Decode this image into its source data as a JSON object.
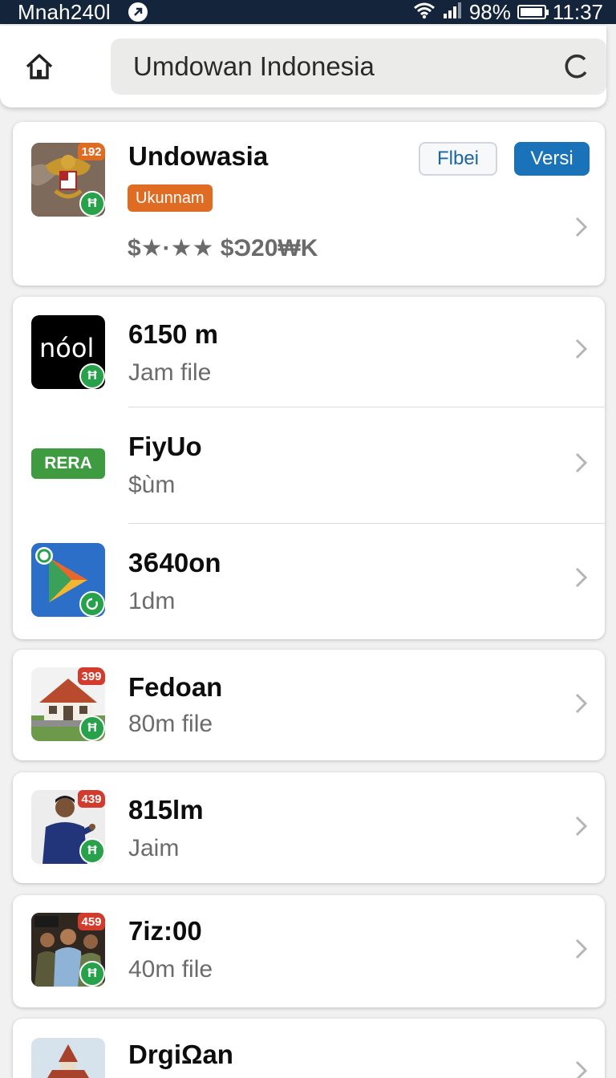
{
  "status_bar": {
    "carrier": "Mnah240l",
    "battery": "98%",
    "battery_level": 0.98,
    "time": "11:37"
  },
  "search": {
    "text": "Umdowan Indonesia"
  },
  "featured": {
    "badge": "192",
    "title": "Undowasia",
    "tag": "Ukunnam",
    "rating": "$★·★★ $Ͽ20₩K",
    "filter_label": "Flbei",
    "version_label": "Versi",
    "accent": "#1a73b9",
    "tag_color": "#e06c24"
  },
  "group": [
    {
      "title": "6150 m",
      "sub": "Jam  file"
    },
    {
      "title": "FiyUo",
      "sub": "$ùm",
      "pill": "RERA"
    },
    {
      "title": "3ϐ40on",
      "sub": "1dm"
    }
  ],
  "group_logo_text": "nόol",
  "items": [
    {
      "badge": "399",
      "title": "Fedoan",
      "sub": "80m  file"
    },
    {
      "badge": "439",
      "title": "815lm",
      "sub": "Jaim"
    },
    {
      "badge": "459",
      "title": "7iz:00",
      "sub": "40m  file"
    },
    {
      "title": "DrgiΩan"
    }
  ],
  "verified_glyph": "Ħ",
  "icons": [
    "home-icon",
    "reload-icon",
    "chevron-right-icon",
    "verified-icon",
    "wifi-icon",
    "signal-icon",
    "battery-icon",
    "nfc-icon"
  ]
}
